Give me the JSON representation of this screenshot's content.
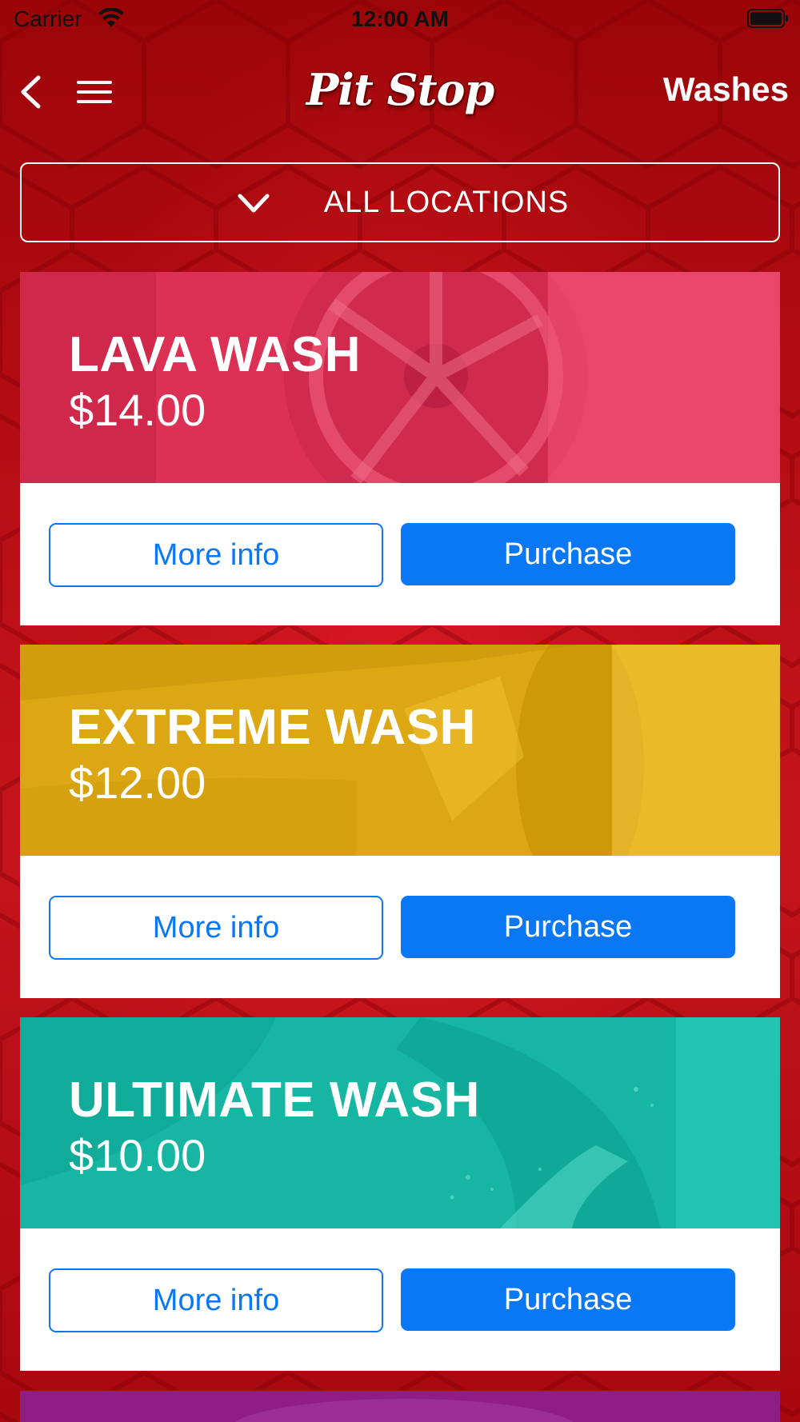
{
  "status_bar": {
    "carrier": "Carrier",
    "time": "12:00 AM"
  },
  "nav": {
    "logo": "Pit Stop",
    "title": "Washes",
    "icons": [
      "back-chevron-icon",
      "hamburger-menu-icon"
    ]
  },
  "location_selector": {
    "label": "ALL LOCATIONS",
    "icon": "chevron-down-icon"
  },
  "washes": [
    {
      "name": "LAVA WASH",
      "price": "$14.00",
      "color": "#e8395c",
      "info_label": "More info",
      "purchase_label": "Purchase"
    },
    {
      "name": "EXTREME WASH",
      "price": "$12.00",
      "color": "#dca712",
      "info_label": "More info",
      "purchase_label": "Purchase"
    },
    {
      "name": "ULTIMATE WASH",
      "price": "$10.00",
      "color": "#16b6a2",
      "info_label": "More info",
      "purchase_label": "Purchase"
    }
  ],
  "colors": {
    "accent_blue": "#0a78f5",
    "background_red": "#b40d14",
    "next_card_purple": "#8e1e86"
  }
}
